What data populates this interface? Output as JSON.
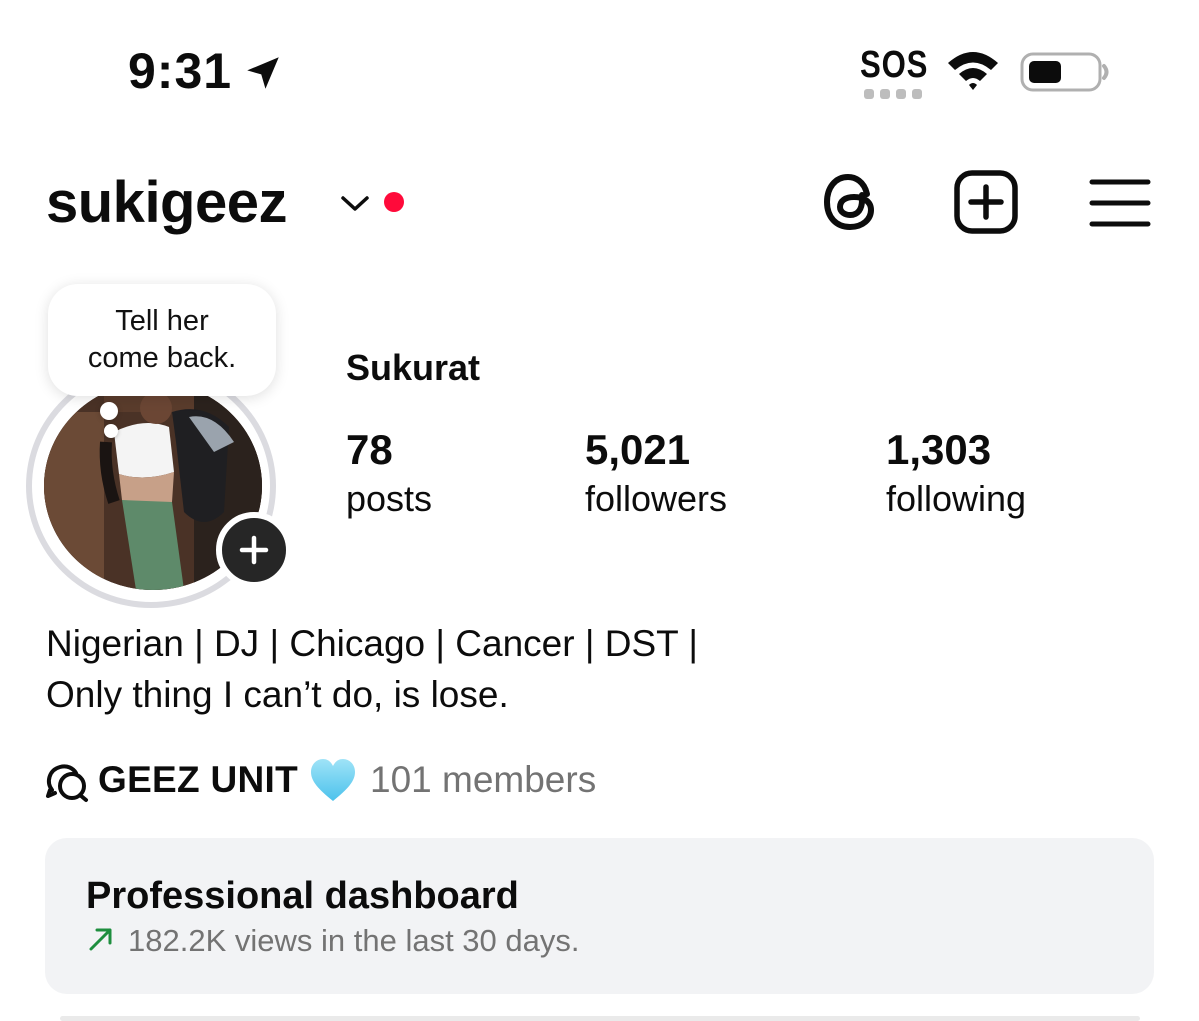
{
  "status_bar": {
    "time": "9:31",
    "location_icon": "location-arrow-icon",
    "sos": "SOS",
    "wifi_icon": "wifi-icon",
    "battery_icon": "battery-icon"
  },
  "header": {
    "username": "sukigeez",
    "chevron_icon": "chevron-down-icon",
    "notification_dot_color": "#ff0a3a",
    "threads_icon": "threads-icon",
    "create_icon": "plus-square-icon",
    "menu_icon": "hamburger-menu-icon"
  },
  "profile": {
    "note_line1": "Tell her",
    "note_line2": "come back.",
    "full_name": "Sukurat",
    "stats": {
      "posts_count": "78",
      "posts_label": "posts",
      "followers_count": "5,021",
      "followers_label": "followers",
      "following_count": "1,303",
      "following_label": "following"
    },
    "bio_line1": "Nigerian | DJ | Chicago | Cancer | DST |",
    "bio_line2": "Only thing I can’t do, is lose."
  },
  "channel": {
    "icon": "broadcast-chat-icon",
    "name": "GEEZ UNIT",
    "emoji_icon": "light-blue-heart-icon",
    "members": "101 members"
  },
  "dashboard": {
    "title": "Professional dashboard",
    "trend_icon": "trend-up-arrow-icon",
    "trend_color": "#1e8e3e",
    "subtitle": "182.2K views in the last 30 days."
  }
}
